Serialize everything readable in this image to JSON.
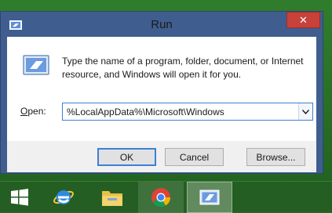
{
  "window": {
    "title": "Run"
  },
  "dialog": {
    "description": "Type the name of a program, folder, document, or Internet resource, and Windows will open it for you.",
    "open_label_accel": "O",
    "open_label_rest": "pen:",
    "input_value": "%LocalAppData%\\Microsoft\\Windows"
  },
  "buttons": {
    "ok": "OK",
    "cancel": "Cancel",
    "browse": "Browse..."
  },
  "taskbar": {
    "items": [
      "windows-start-icon",
      "internet-explorer-icon",
      "file-explorer-icon",
      "chrome-icon",
      "run-icon"
    ]
  },
  "colors": {
    "title_bar": "#3f5e8f",
    "close_button": "#c7423a",
    "focus_border": "#3c7fd6",
    "desktop": "#2e6b2f"
  }
}
